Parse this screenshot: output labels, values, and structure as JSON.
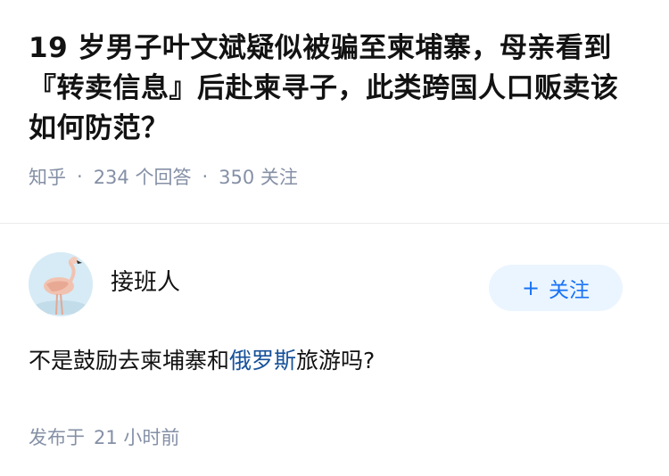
{
  "question": {
    "title": "19 岁男子叶文斌疑似被骗至柬埔寨，母亲看到『转卖信息』后赴柬寻子，此类跨国人口贩卖该如何防范？",
    "source": "知乎",
    "answers_count": "234 个回答",
    "followers_count": "350 关注",
    "separator": "·"
  },
  "answer": {
    "author_name": "接班人",
    "follow_label": "关注",
    "follow_plus": "+",
    "body_before_link": "不是鼓励去柬埔寨和",
    "body_link": "俄罗斯",
    "body_after_link": "旅游吗?",
    "published_label": "发布于",
    "published_time": "21 小时前",
    "avatar_icon": "flamingo-avatar"
  },
  "colors": {
    "link": "#175199",
    "meta": "#8590a6",
    "follow_bg": "#ebf5ff",
    "follow_text": "#1772f6"
  }
}
